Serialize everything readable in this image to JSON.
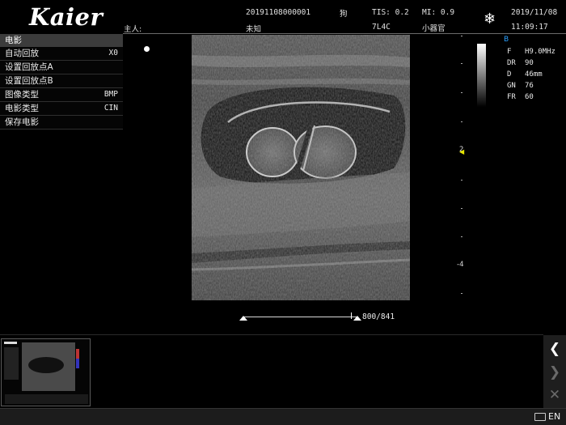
{
  "header": {
    "brand": "Kaier",
    "patient_id": "20191108000001",
    "owner_label": "主人:",
    "owner_name": "未知",
    "species": "狗",
    "tis": "TIS: 0.2",
    "mi": "MI: 0.9",
    "probe": "7L4C",
    "preset": "小器官",
    "date": "2019/11/08",
    "time": "11:09:17",
    "freeze_icon": "snowflake-icon"
  },
  "menu": {
    "title": "电影",
    "items": [
      {
        "label": "自动回放",
        "value": "X0"
      },
      {
        "label": "设置回放点A",
        "value": ""
      },
      {
        "label": "设置回放点B",
        "value": ""
      },
      {
        "label": "图像类型",
        "value": "BMP"
      },
      {
        "label": "电影类型",
        "value": "CIN"
      },
      {
        "label": "保存电影",
        "value": ""
      }
    ]
  },
  "depth_scale": {
    "labels": [
      "2",
      "4"
    ],
    "marker_color": "#e4e400"
  },
  "params": {
    "mode": "B",
    "rows": [
      {
        "key": "F",
        "value": "H9.0MHz"
      },
      {
        "key": "DR",
        "value": "90"
      },
      {
        "key": "D",
        "value": "46mm"
      },
      {
        "key": "GN",
        "value": "76"
      },
      {
        "key": "FR",
        "value": "60"
      }
    ]
  },
  "cine": {
    "frame_counter": "800/841",
    "current_frame": 800,
    "total_frames": 841
  },
  "side_buttons": [
    "chevron-left-icon",
    "chevron-right-icon",
    "close-icon"
  ],
  "status": {
    "language": "EN",
    "keyboard_icon": "keyboard-icon"
  },
  "colors": {
    "mode_label": "#2aa0ff",
    "menu_title_bg": "#3c3c3c"
  }
}
